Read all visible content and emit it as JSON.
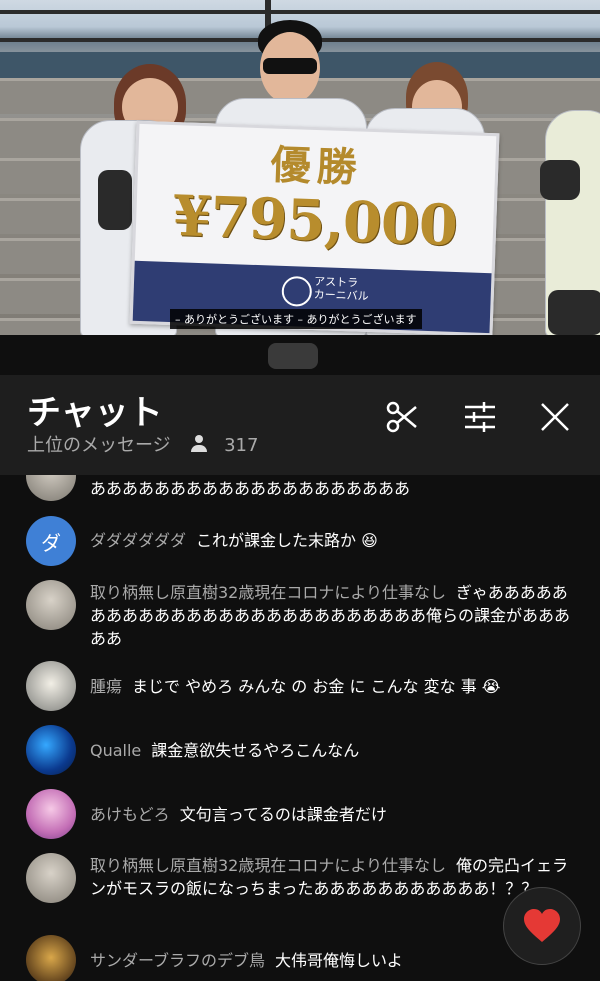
{
  "video": {
    "sign_title": "優勝",
    "sign_amount": "¥795,000",
    "sign_brand_line1": "アストラ",
    "sign_brand_line2": "カーニバル",
    "subtitle": "– ありがとうございます – ありがとうございます"
  },
  "chat": {
    "title": "チャット",
    "mode_label": "上位のメッセージ",
    "viewer_count": "317",
    "icons": {
      "clip": "scissors-icon",
      "filter": "sliders-icon",
      "close": "close-icon",
      "like": "heart-icon"
    },
    "messages": [
      {
        "author": "",
        "text": "ああああああああああああああああああああ",
        "avatar": "photo"
      },
      {
        "author": "ダダダダダダ",
        "text": "これが課金した末路か 😆",
        "avatar_letter": "ダ",
        "avatar_color": "#3f80d6"
      },
      {
        "author": "取り柄無し原直樹32歳現在コロナにより仕事なし",
        "text": "ぎゃああああああああああああああああああああああああああ俺らの課金があああああ",
        "avatar": "photo"
      },
      {
        "author": "腫瘍",
        "text": "まじで やめろ みんな の お金 に こんな 変な 事 😭",
        "avatar": "anime"
      },
      {
        "author": "Qualle",
        "text": "課金意欲失せるやろこんなん",
        "avatar": "jellyfish"
      },
      {
        "author": "あけもどろ",
        "text": "文句言ってるのは課金者だけ",
        "avatar": "pink"
      },
      {
        "author": "取り柄無し原直樹32歳現在コロナにより仕事なし",
        "text": "俺の完凸イェランがモスラの飯になっちまったあああああああああああ！？？",
        "avatar": "photo"
      },
      {
        "author": "サンダーブラフのデブ鳥",
        "text": "大伟哥俺悔しいよ",
        "avatar": "bird"
      }
    ]
  },
  "colors": {
    "background": "#0f0f0f",
    "header": "#1e1e1e",
    "author": "#aaaaaa",
    "heart": "#e53935"
  }
}
